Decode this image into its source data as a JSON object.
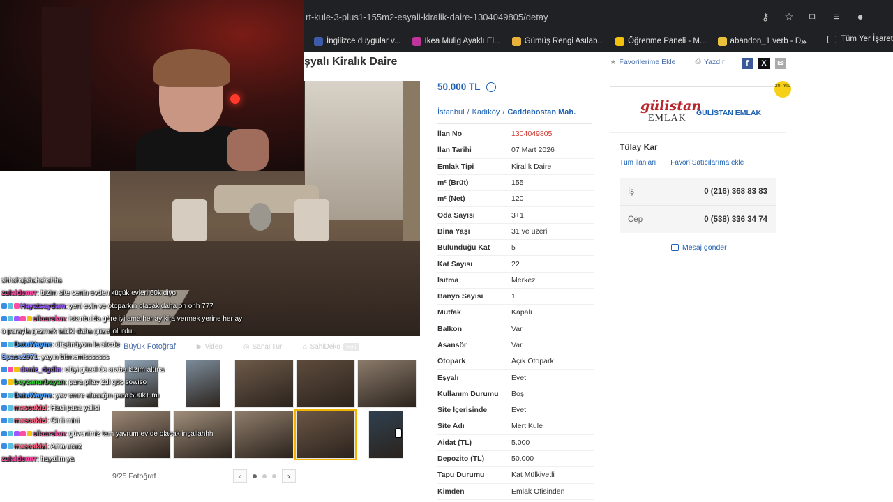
{
  "browser": {
    "url": "rt-kule-3-plus1-155m2-esyali-kiralik-daire-1304049805/detay",
    "bookmarks": [
      {
        "label": "İngilizce duygular v...",
        "color": "#3c5ba8"
      },
      {
        "label": "Ikea Mulig Ayaklı El...",
        "color": "#c0359b"
      },
      {
        "label": "Gümüş Rengi Asılab...",
        "color": "#e8b23a"
      },
      {
        "label": "Öğrenme Paneli - M...",
        "color": "#f4c20d"
      },
      {
        "label": "abandon_1 verb - D...",
        "color": "#e8c23a"
      }
    ],
    "more_label": "»",
    "folder_label": "Tüm Yer İşaretle"
  },
  "listing": {
    "title": "şyalı Kiralık Daire",
    "favorite_label": "Favorilerime Ekle",
    "print_label": "Yazdır",
    "price": "50.000 TL",
    "breadcrumbs": [
      "İstanbul",
      "Kadıköy",
      "Caddebostan Mah."
    ],
    "attributes": [
      {
        "key": "İlan No",
        "value": "1304049805",
        "highlight": true
      },
      {
        "key": "İlan Tarihi",
        "value": "07 Mart 2026"
      },
      {
        "key": "Emlak Tipi",
        "value": "Kiralık Daire"
      },
      {
        "key": "m² (Brüt)",
        "value": "155"
      },
      {
        "key": "m² (Net)",
        "value": "120"
      },
      {
        "key": "Oda Sayısı",
        "value": "3+1"
      },
      {
        "key": "Bina Yaşı",
        "value": "31 ve üzeri"
      },
      {
        "key": "Bulunduğu Kat",
        "value": "5"
      },
      {
        "key": "Kat Sayısı",
        "value": "22"
      },
      {
        "key": "Isıtma",
        "value": "Merkezi"
      },
      {
        "key": "Banyo Sayısı",
        "value": "1"
      },
      {
        "key": "Mutfak",
        "value": "Kapalı"
      },
      {
        "key": "Balkon",
        "value": "Var"
      },
      {
        "key": "Asansör",
        "value": "Var"
      },
      {
        "key": "Otopark",
        "value": "Açık Otopark"
      },
      {
        "key": "Eşyalı",
        "value": "Evet"
      },
      {
        "key": "Kullanım Durumu",
        "value": "Boş"
      },
      {
        "key": "Site İçerisinde",
        "value": "Evet"
      },
      {
        "key": "Site Adı",
        "value": "Mert Kule"
      },
      {
        "key": "Aidat (TL)",
        "value": "5.000"
      },
      {
        "key": "Depozito (TL)",
        "value": "50.000"
      },
      {
        "key": "Tapu Durumu",
        "value": "Kat Mülkiyetli"
      },
      {
        "key": "Kimden",
        "value": "Emlak Ofisinden"
      }
    ]
  },
  "gallery": {
    "tabs": [
      {
        "label": "Büyük Fotoğraf",
        "active": true
      },
      {
        "label": "Video",
        "active": false
      },
      {
        "label": "Sanal Tur",
        "active": false
      },
      {
        "label": "SahiDeko",
        "active": false,
        "badge": "yeni"
      }
    ],
    "photo_count": "9/25 Fotoğraf",
    "thumbs": [
      {
        "color": "#8fa3b6"
      },
      {
        "color": "#7b8b99"
      },
      {
        "color": "#6d5a49"
      },
      {
        "color": "#5d4b3c"
      },
      {
        "color": "#8a7a6a"
      },
      {
        "color": "#9a8674"
      },
      {
        "color": "#a08e7a"
      },
      {
        "color": "#8f7d6b"
      },
      {
        "color": "#6b5645",
        "selected": true
      },
      {
        "color": "#2f4050"
      }
    ],
    "prev": "‹",
    "next": "›"
  },
  "seller": {
    "badge": "20. YIL",
    "logo_main": "gülistan",
    "logo_sub": "EMLAK",
    "firm": "GÜLİSTAN EMLAK",
    "agent": "Tülay Kar",
    "all_listings": "Tüm ilanları",
    "add_favorite_seller": "Favori Satıcılarıma ekle",
    "phones": [
      {
        "label": "İş",
        "number": "0 (216) 368 83 83"
      },
      {
        "label": "Cep",
        "number": "0 (538) 336 34 74"
      }
    ],
    "message_label": "Mesaj gönder"
  },
  "chat": {
    "lines": [
      {
        "user": "",
        "text": "shhshsjshshshshhs",
        "color": "#ffffff",
        "badges": []
      },
      {
        "user": "zulaldemrr",
        "text": ": bizim site senin evden küçük evleri 60k diyo",
        "color": "#ff4da6",
        "badges": []
      },
      {
        "user": "Hayatsaydam",
        "text": ": yeni evin ve otoparkın olacak daha oh ohh 777",
        "color": "#9b59ff",
        "badges": [
          "#3a8ee6",
          "#5bc0de",
          "#ff4da6"
        ]
      },
      {
        "user": "silaarslan",
        "text": ": istanbulda göre iyi ama her ay kira vermek yerine her ay",
        "color": "#ff4da6",
        "badges": [
          "#3a8ee6",
          "#5bc0de",
          "#9b59ff",
          "#ff4da6",
          "#f4c20d"
        ]
      },
      {
        "user": "",
        "text": "o parayla gezmek tabiki daha güzel olurdu..",
        "color": "#ffffff",
        "badges": []
      },
      {
        "user": "BatuWayne",
        "text": ": düşünüyom la sitede",
        "color": "#4aa3ff",
        "badges": [
          "#3a8ee6",
          "#5bc0de"
        ]
      },
      {
        "user": "Space2971",
        "text": ": yayın bitmemisssssss",
        "color": "#8ab4ff",
        "badges": []
      },
      {
        "user": "deniz_dgdln",
        "text": ": sitiyi güzel de araba lazım altına",
        "color": "#9b59ff",
        "badges": [
          "#3a8ee6",
          "#ff4da6",
          "#f4c20d"
        ]
      },
      {
        "user": "beyzanurbayan",
        "text": ": para pilav 2dl gös sowiso",
        "color": "#33cc33",
        "badges": [
          "#3a8ee6",
          "#f4c20d"
        ]
      },
      {
        "user": "BatuWayne",
        "text": ": yav emre alacağın para 500k+ mı",
        "color": "#4aa3ff",
        "badges": [
          "#3a8ee6",
          "#5bc0de"
        ]
      },
      {
        "user": "mascakizi",
        "text": ": Haci pasa yalisi",
        "color": "#ff6b8a",
        "badges": [
          "#3a8ee6",
          "#5bc0de"
        ]
      },
      {
        "user": "mascakizi",
        "text": ": Cinli mini",
        "color": "#ff6b8a",
        "badges": [
          "#3a8ee6",
          "#5bc0de"
        ]
      },
      {
        "user": "silaarslan",
        "text": ": güvenimiz tam yavrum ev de olacak inşallahhh",
        "color": "#ff4da6",
        "badges": [
          "#3a8ee6",
          "#5bc0de",
          "#9b59ff",
          "#ff4da6",
          "#f4c20d"
        ]
      },
      {
        "user": "mascakizi",
        "text": ": Ama ucuz",
        "color": "#ff6b8a",
        "badges": [
          "#3a8ee6",
          "#5bc0de"
        ]
      },
      {
        "user": "zulaldemrr",
        "text": ": hayalim ya",
        "color": "#ff4da6",
        "badges": []
      }
    ]
  }
}
